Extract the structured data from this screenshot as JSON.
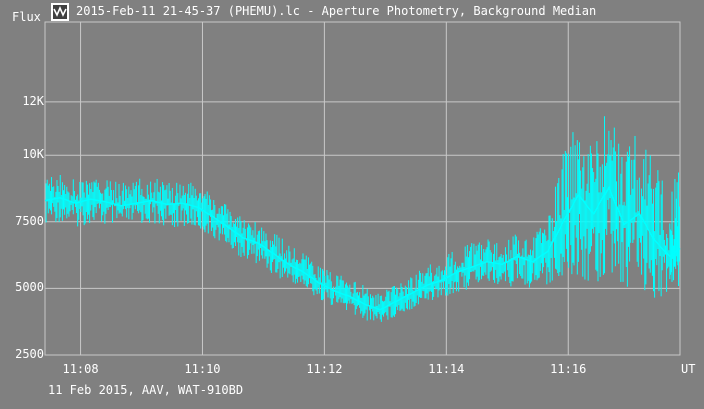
{
  "window": {
    "title": "2015-Feb-11 21-45-37 (PHEMU).lc - Aperture Photometry, Background Median"
  },
  "footer": {
    "text": "11 Feb 2015, AAV, WAT-910BD"
  },
  "icons": {
    "app": "lightcurve-app-icon"
  },
  "colors": {
    "background": "#808080",
    "grid": "#c8c8c8",
    "series": "#00ffff",
    "text": "#ffffff"
  },
  "chart_data": {
    "type": "line",
    "title": "",
    "ylabel": "Flux",
    "xlabel": "",
    "x_unit_label": "UT",
    "x_ticks": [
      "11:08",
      "11:10",
      "11:12",
      "11:14",
      "11:16"
    ],
    "y_ticks": [
      {
        "value": 2500,
        "label": "2500"
      },
      {
        "value": 5000,
        "label": "5000"
      },
      {
        "value": 7500,
        "label": "7500"
      },
      {
        "value": 10000,
        "label": "10K"
      },
      {
        "value": 12000,
        "label": "12K"
      }
    ],
    "xlim": [
      "11:07:25",
      "11:17:50"
    ],
    "ylim": [
      2500,
      15000
    ],
    "grid": true,
    "series": [
      {
        "x": [
          "11:07:25",
          "11:07:40",
          "11:07:55",
          "11:08:10",
          "11:08:25",
          "11:08:40",
          "11:08:55",
          "11:09:10",
          "11:09:25",
          "11:09:40",
          "11:09:55",
          "11:10:10",
          "11:10:25",
          "11:10:40",
          "11:10:55",
          "11:11:10",
          "11:11:25",
          "11:11:40",
          "11:11:55",
          "11:12:10",
          "11:12:25",
          "11:12:40",
          "11:12:55",
          "11:13:10",
          "11:13:25",
          "11:13:40",
          "11:13:55",
          "11:14:10",
          "11:14:25",
          "11:14:40",
          "11:14:55",
          "11:15:10",
          "11:15:25",
          "11:15:40",
          "11:15:55",
          "11:16:10",
          "11:16:25",
          "11:16:40",
          "11:16:55",
          "11:17:10",
          "11:17:25",
          "11:17:40",
          "11:17:50"
        ],
        "y": [
          8300,
          8400,
          8200,
          8350,
          8250,
          8100,
          8200,
          8300,
          8150,
          8200,
          8050,
          7700,
          7300,
          6900,
          6700,
          6300,
          5900,
          5600,
          5200,
          4900,
          4700,
          4400,
          4200,
          4500,
          4800,
          5100,
          5300,
          5600,
          5800,
          6000,
          5900,
          6200,
          6000,
          6400,
          7500,
          8500,
          7800,
          8800,
          7400,
          7800,
          6800,
          6200,
          6500
        ],
        "min": [
          7400,
          7500,
          7300,
          7400,
          7300,
          7300,
          7400,
          7400,
          7300,
          7300,
          7200,
          6900,
          6500,
          6100,
          5900,
          5500,
          5200,
          4900,
          4600,
          4300,
          4000,
          3800,
          3700,
          3900,
          4200,
          4400,
          4600,
          4800,
          5000,
          5200,
          5000,
          5100,
          5000,
          5100,
          5200,
          5300,
          5200,
          5200,
          5000,
          5100,
          4600,
          4800,
          5000
        ],
        "max": [
          9200,
          9300,
          9100,
          9200,
          9100,
          9000,
          9100,
          9200,
          9000,
          9100,
          9000,
          8500,
          8100,
          7700,
          7500,
          7100,
          6700,
          6300,
          5900,
          5600,
          5400,
          5100,
          4800,
          5200,
          5500,
          5900,
          6100,
          6500,
          6700,
          6900,
          6800,
          7200,
          7000,
          7600,
          10200,
          11600,
          10100,
          12300,
          10600,
          10900,
          9800,
          8300,
          10100
        ]
      }
    ]
  }
}
